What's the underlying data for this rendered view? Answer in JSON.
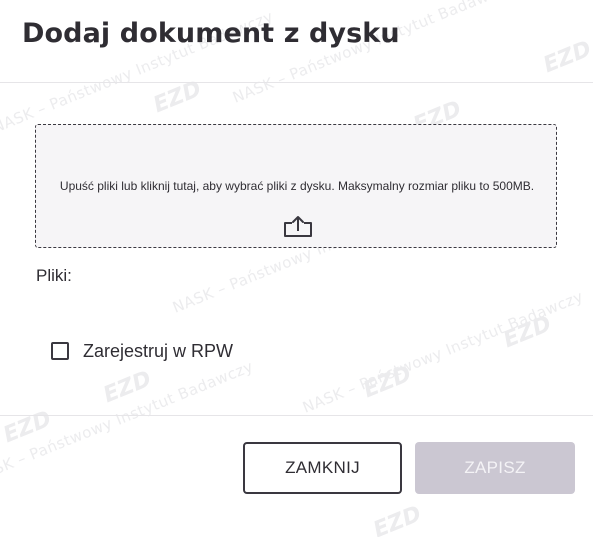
{
  "dialog": {
    "title": "Dodaj dokument z dysku"
  },
  "dropzone": {
    "instruction": "Upuść pliki lub kliknij tutaj, aby wybrać pliki z dysku. Maksymalny rozmiar pliku to 500MB.",
    "icon": "upload-icon"
  },
  "files": {
    "label": "Pliki:"
  },
  "rpw_checkbox": {
    "label": "Zarejestruj w RPW",
    "checked": false
  },
  "buttons": {
    "close_label": "ZAMKNIJ",
    "save_label": "ZAPISZ",
    "save_enabled": false
  },
  "watermark": {
    "text": "NASK – Państwowy Instytut Badawczy",
    "logo": "EZD"
  },
  "colors": {
    "text": "#2f2d33",
    "border": "#3a3840",
    "dropzone_bg": "#f6f5f7",
    "save_disabled_bg": "#cbc7d2",
    "divider": "#e6e5e8"
  }
}
